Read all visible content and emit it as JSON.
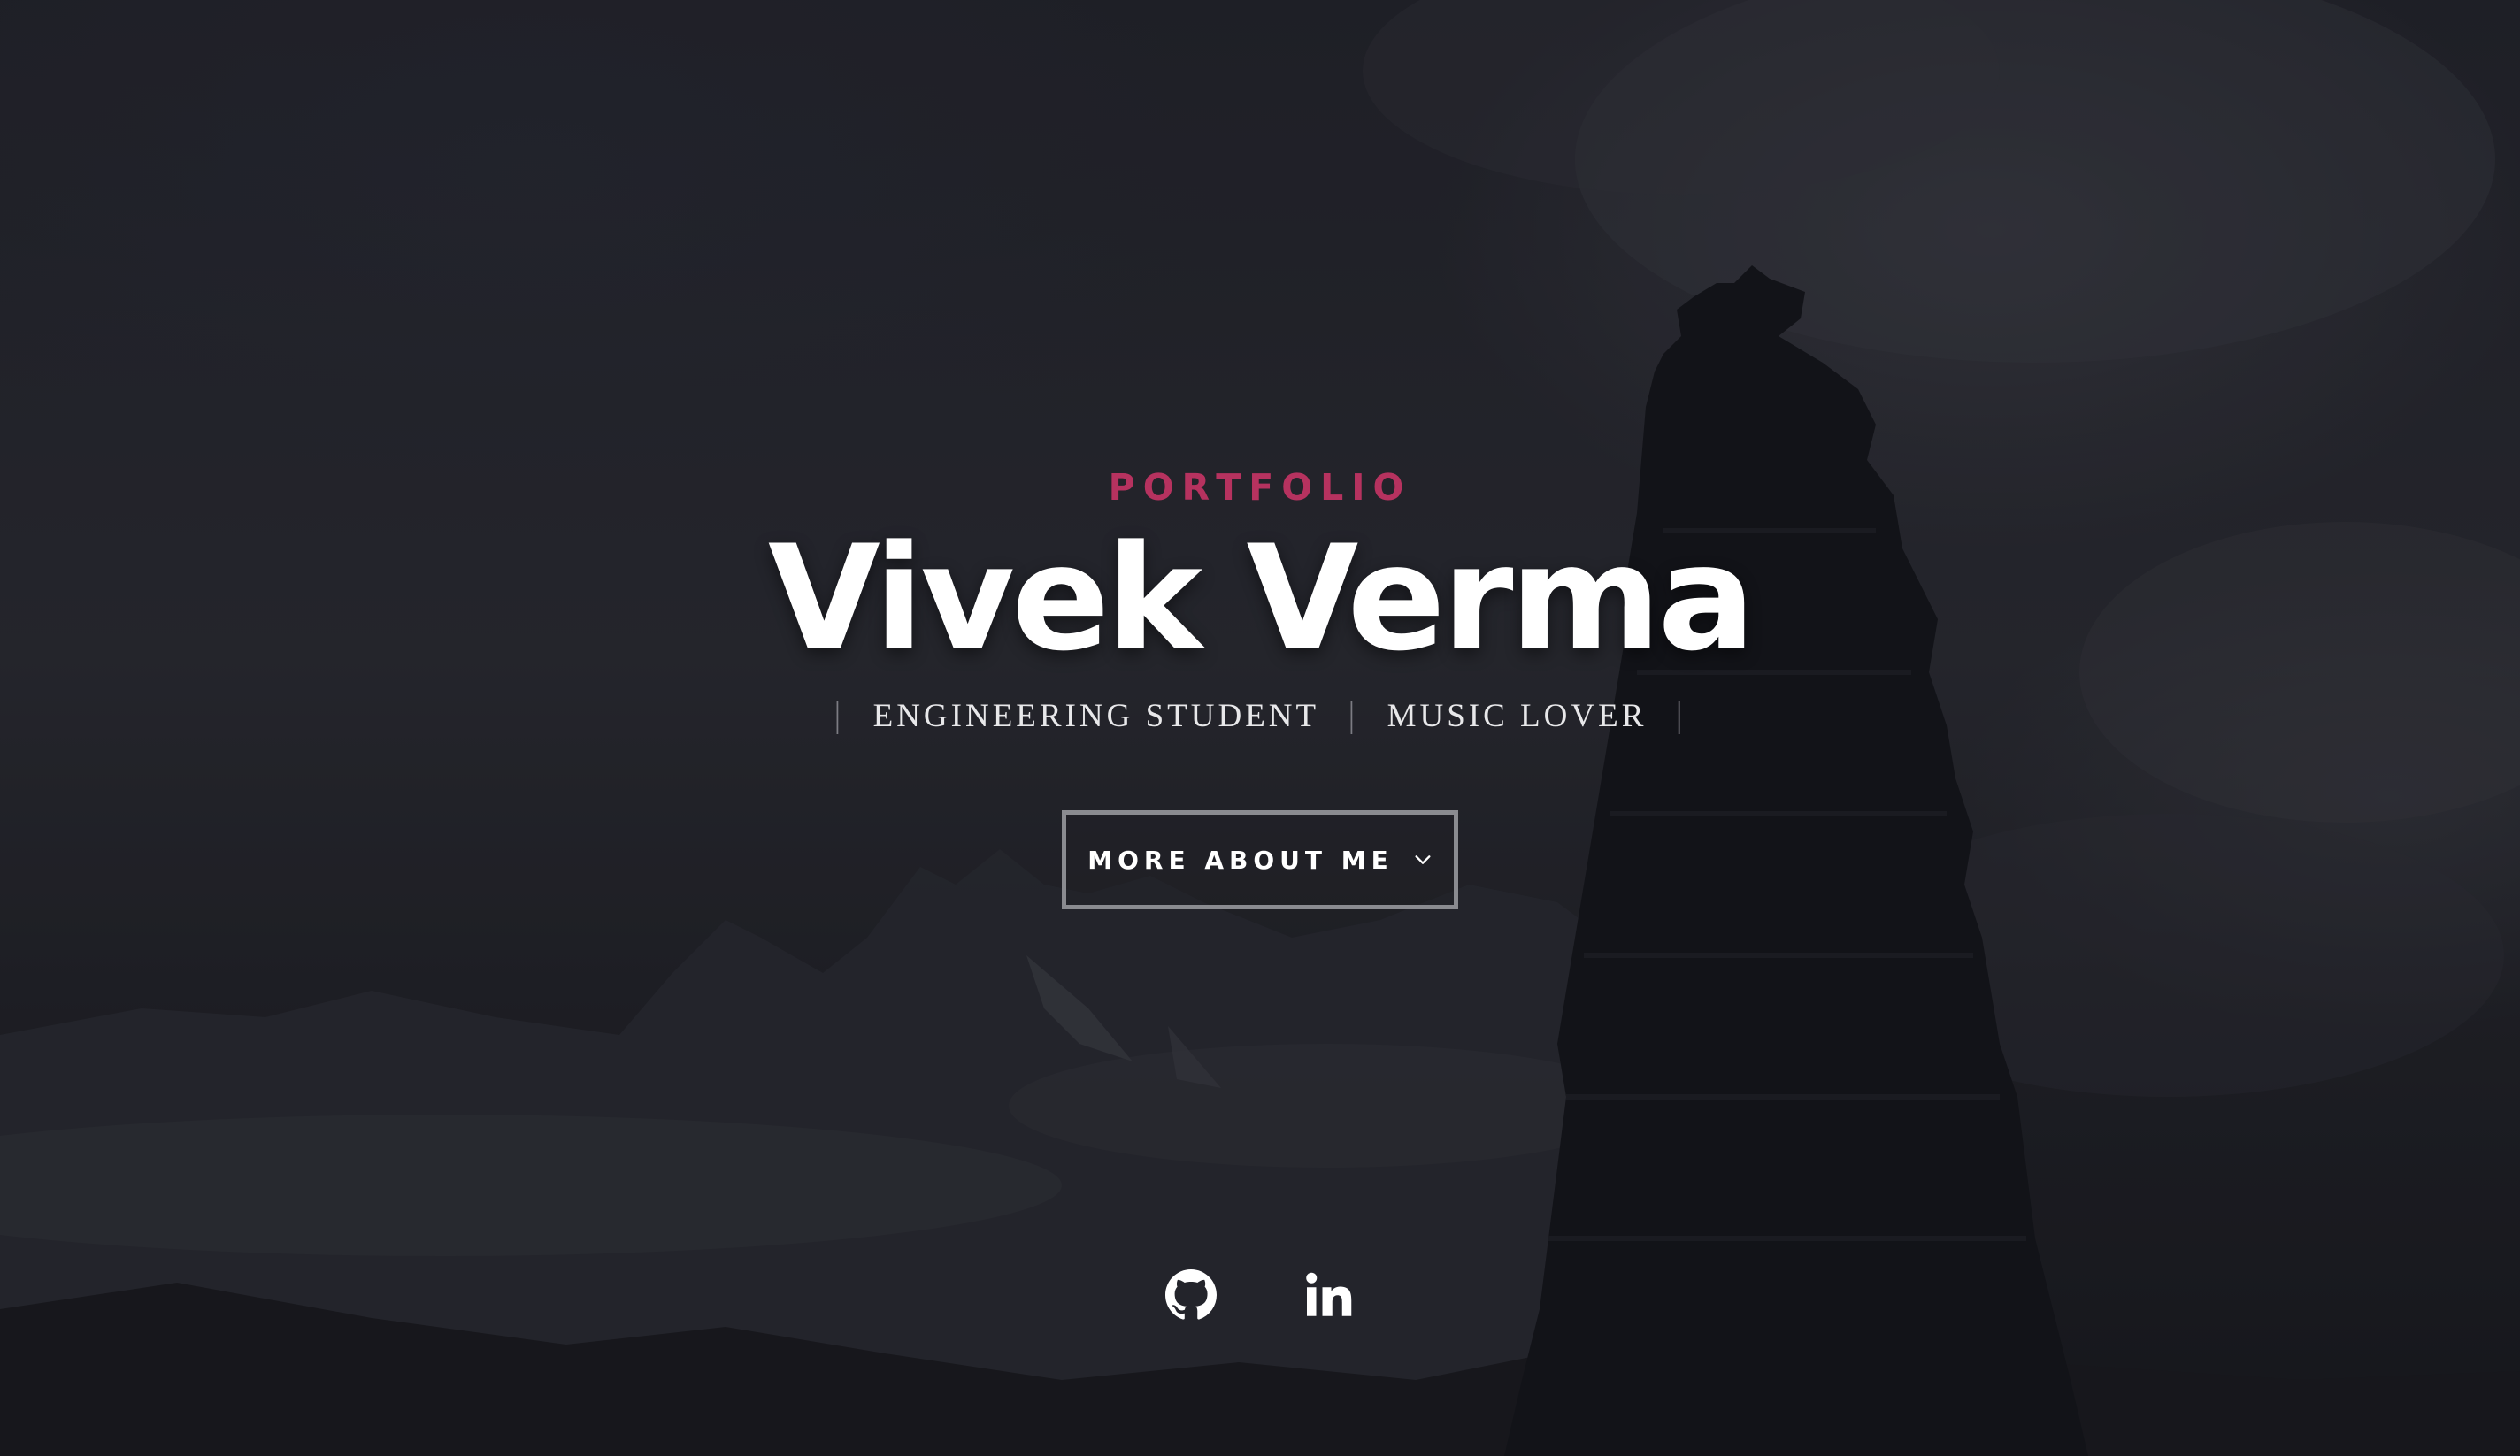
{
  "hero": {
    "kicker": "PORTFOLIO",
    "name": "Vivek Verma",
    "tagline": {
      "items": [
        "ENGINEERING STUDENT",
        "MUSIC LOVER"
      ],
      "separator": "|"
    },
    "cta": {
      "label": "MORE ABOUT ME",
      "icon": "chevron-down-icon"
    }
  },
  "social": [
    {
      "icon": "github-icon"
    },
    {
      "icon": "linkedin-icon"
    }
  ],
  "colors": {
    "accent": "#b6325f",
    "text": "#ffffff",
    "background": "#1b1c21",
    "button_border": "#8a8b90"
  },
  "background_image": "dark mountain landscape with stone cairn"
}
